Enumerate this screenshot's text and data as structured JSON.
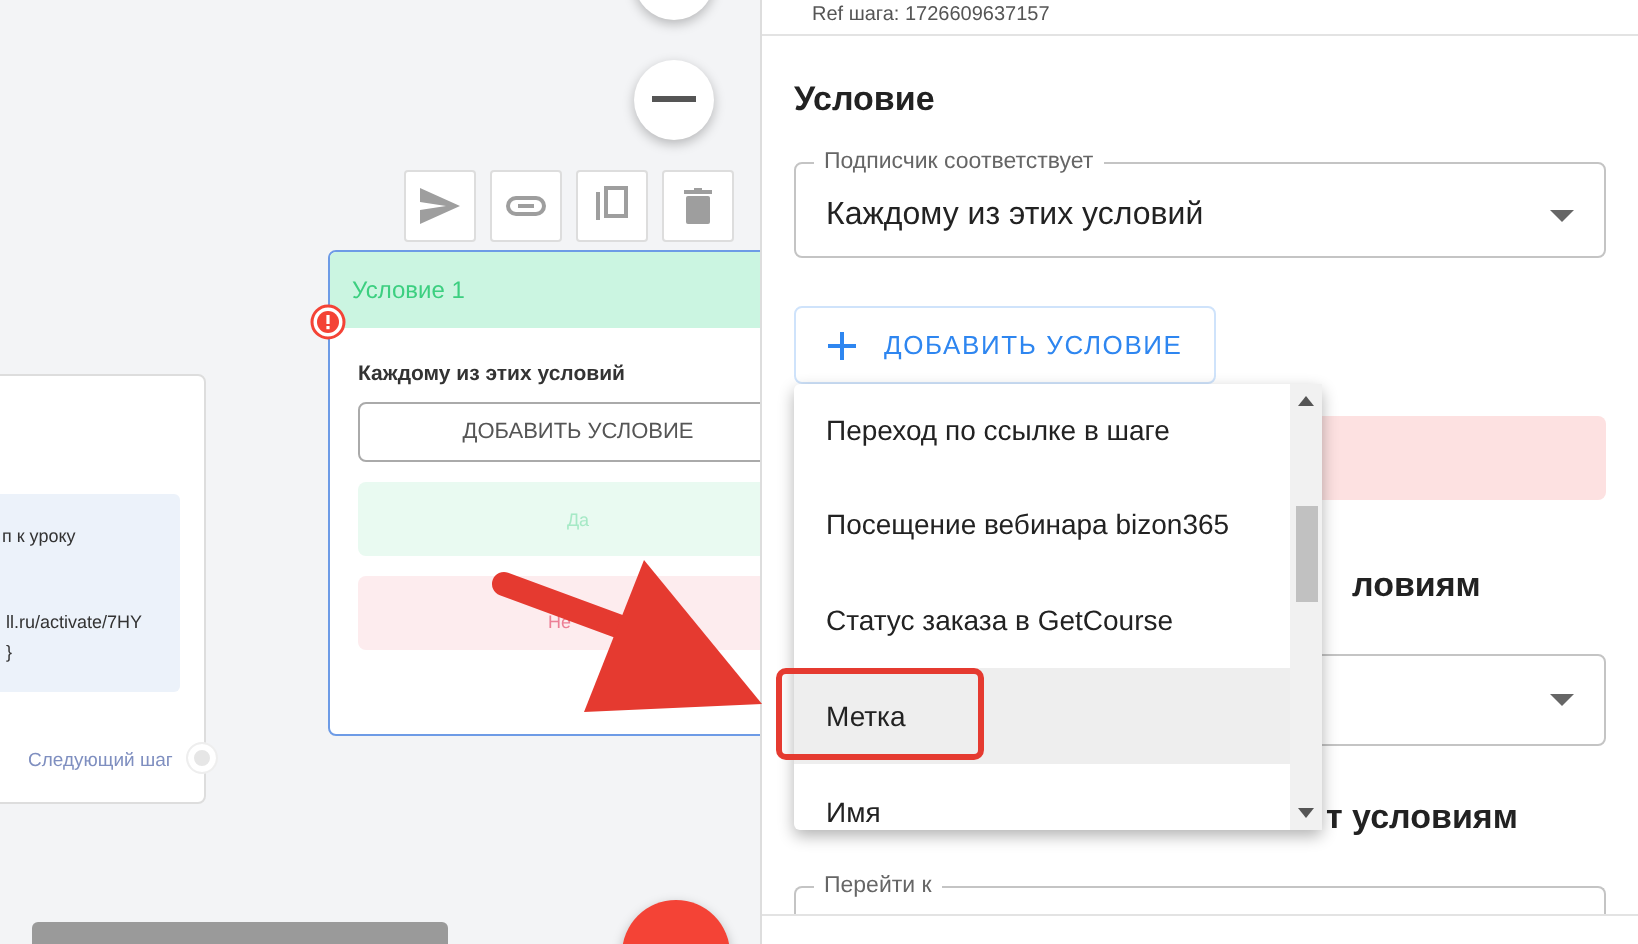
{
  "canvas": {
    "left_node": {
      "lines": [
        "п к уроку",
        "ll.ru/activate/7HY",
        "}"
      ],
      "next_label": "Следующий шаг"
    },
    "condition_node": {
      "title": "Условие 1",
      "error": true,
      "subtitle": "Каждому из этих условий",
      "add_button": "ДОБАВИТЬ УСЛОВИЕ",
      "yes_label": "Да",
      "no_label": "Не"
    }
  },
  "panel": {
    "ref_line": "Ref шага: 1726609637157",
    "heading": "Условие",
    "match_select": {
      "label": "Подписчик соответствует",
      "value": "Каждому из этих условий"
    },
    "add_button": "ДОБАВИТЬ УСЛОВИЕ",
    "heading_2": "ловиям",
    "heading_3": "т условиям",
    "goto_field": {
      "label": "Перейти к"
    }
  },
  "dropdown": {
    "items": [
      {
        "label": "Переход по ссылке в шаге",
        "selected": false
      },
      {
        "label": "Посещение вебинара bizon365",
        "selected": false
      },
      {
        "label": "Статус заказа в GetCourse",
        "selected": false
      },
      {
        "label": "Метка",
        "selected": true
      },
      {
        "label": "Имя",
        "selected": false
      }
    ]
  }
}
